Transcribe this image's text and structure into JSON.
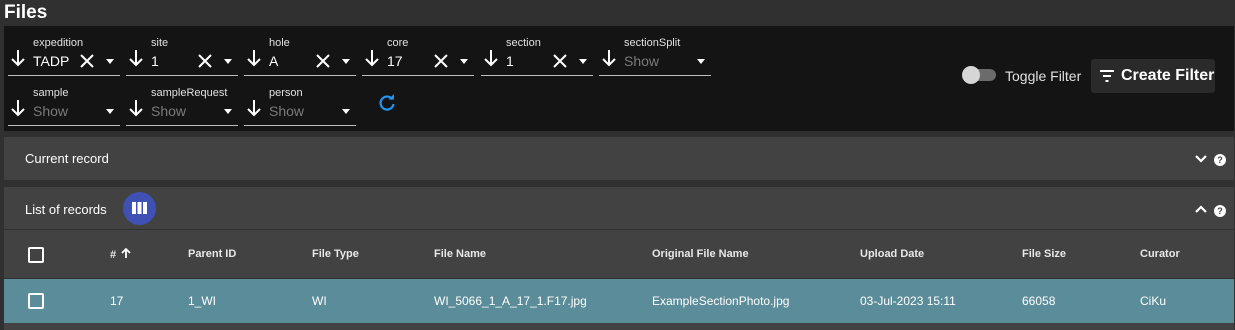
{
  "page": {
    "title": "Files"
  },
  "filters": [
    {
      "label": "expedition",
      "value": "TADP",
      "placeholder": false,
      "clearable": true
    },
    {
      "label": "site",
      "value": "1",
      "placeholder": false,
      "clearable": true
    },
    {
      "label": "hole",
      "value": "A",
      "placeholder": false,
      "clearable": true
    },
    {
      "label": "core",
      "value": "17",
      "placeholder": false,
      "clearable": true
    },
    {
      "label": "section",
      "value": "1",
      "placeholder": false,
      "clearable": true
    },
    {
      "label": "sectionSplit",
      "value": "Show",
      "placeholder": true,
      "clearable": false
    },
    {
      "label": "sample",
      "value": "Show",
      "placeholder": true,
      "clearable": false
    },
    {
      "label": "sampleRequest",
      "value": "Show",
      "placeholder": true,
      "clearable": false
    },
    {
      "label": "person",
      "value": "Show",
      "placeholder": true,
      "clearable": false
    }
  ],
  "toolbar": {
    "toggle_filter_label": "Toggle Filter",
    "toggle_filter_on": false,
    "create_filter_label": "Create Filter"
  },
  "current_record": {
    "title": "Current record",
    "expanded": false
  },
  "list_of_records": {
    "title": "List of records",
    "expanded": true
  },
  "table": {
    "columns": [
      "# ",
      "Parent ID",
      "File Type",
      "File Name",
      "Original File Name",
      "Upload Date",
      "File Size",
      "Curator"
    ],
    "sort": {
      "column": "#",
      "direction": "ascending"
    },
    "rows": [
      [
        "17",
        "1_WI",
        "WI",
        "WI_5066_1_A_17_1.F17.jpg",
        "ExampleSectionPhoto.jpg",
        "03-Jul-2023 15:11",
        "66058",
        "CiKu"
      ]
    ]
  },
  "colors": {
    "accent": "#3f51b5",
    "refresh": "#2196f3",
    "selected_row": "#5b8c99"
  }
}
